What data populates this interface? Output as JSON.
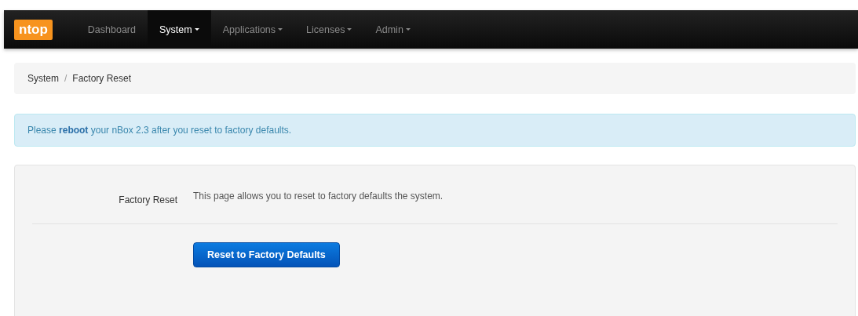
{
  "navbar": {
    "logo": "ntop",
    "items": [
      {
        "label": "Dashboard",
        "selected": false,
        "has_menu": false
      },
      {
        "label": "System",
        "selected": true,
        "has_menu": true
      },
      {
        "label": "Applications",
        "selected": false,
        "has_menu": true
      },
      {
        "label": "Licenses",
        "selected": false,
        "has_menu": true
      },
      {
        "label": "Admin",
        "selected": false,
        "has_menu": true
      }
    ]
  },
  "breadcrumb": [
    "System",
    "Factory Reset"
  ],
  "breadcrumb_separator": "/",
  "alert": {
    "before": "Please",
    "link": "reboot",
    "after": "your nBox 2.3 after you reset to factory defaults."
  },
  "form": {
    "label": "Factory Reset",
    "description": "This page allows you to reset to factory defaults the system.",
    "button": "Reset to Factory Defaults"
  }
}
